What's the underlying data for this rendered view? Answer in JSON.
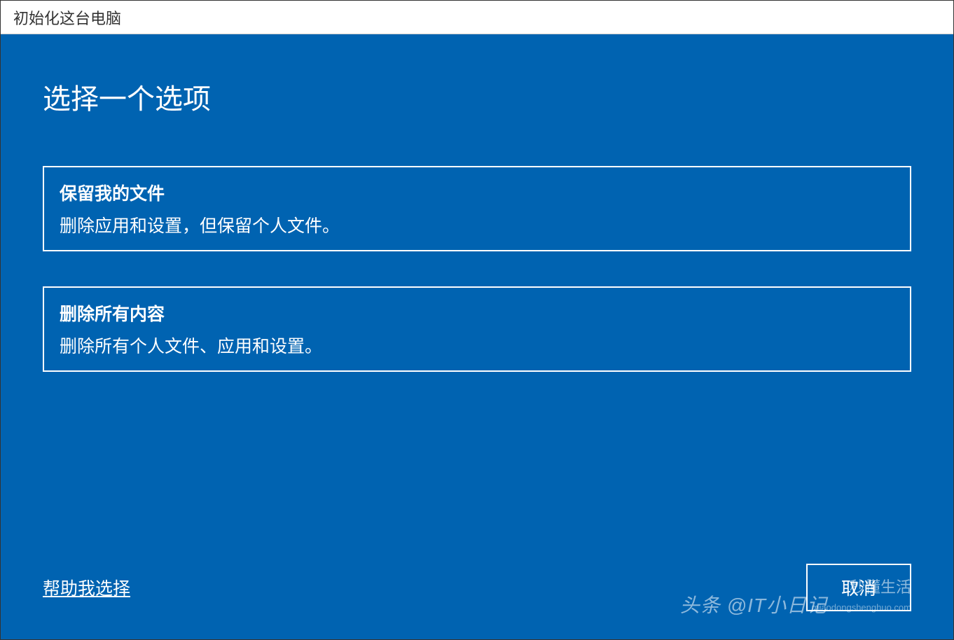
{
  "window": {
    "title": "初始化这台电脑"
  },
  "main": {
    "heading": "选择一个选项",
    "options": [
      {
        "title": "保留我的文件",
        "description": "删除应用和设置，但保留个人文件。"
      },
      {
        "title": "删除所有内容",
        "description": "删除所有个人文件、应用和设置。"
      }
    ],
    "help_link": "帮助我选择",
    "cancel_button": "取消"
  },
  "watermark": {
    "main": "头条 @IT小日记",
    "sub": "秒懂生活",
    "url": "miaodongshenghuo.com"
  }
}
